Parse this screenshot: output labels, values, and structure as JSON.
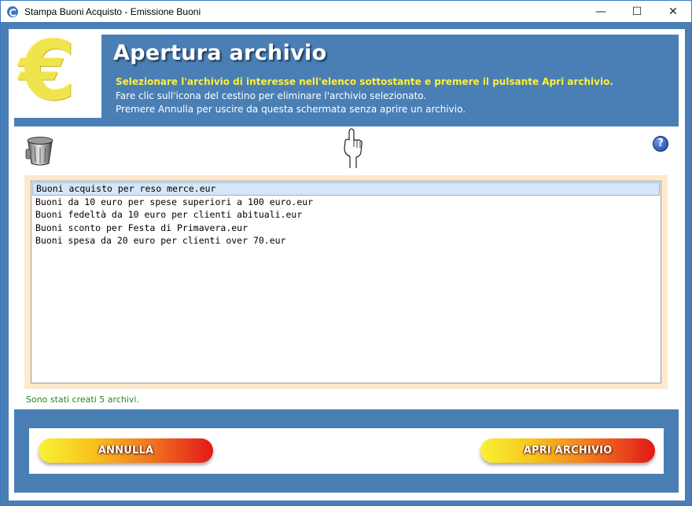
{
  "window": {
    "title": "Stampa Buoni Acquisto - Emissione Buoni",
    "minimize": "—",
    "maximize": "☐",
    "close": "✕"
  },
  "header": {
    "logo_symbol": "€",
    "title": "Apertura archivio",
    "line1": "Selezionare l'archivio di interesse nell'elenco sottostante e premere il pulsante Apri archivio.",
    "line2": "Fare clic sull'icona del cestino per eliminare l'archivio selezionato.",
    "line3": "Premere Annulla per uscire da questa schermata senza aprire un archivio.",
    "colors": {
      "background": "#4a7fb5",
      "highlight": "#ffef3a"
    }
  },
  "toolbar": {
    "help_label": "?",
    "icons": [
      "trash-icon",
      "pointing-hand-icon",
      "help-icon"
    ]
  },
  "file_list": {
    "items": [
      "Buoni acquisto per reso merce.eur",
      "Buoni da 10 euro per spese superiori a 100 euro.eur",
      "Buoni fedeltà da 10 euro per clienti abituali.eur",
      "Buoni sconto per Festa di Primavera.eur",
      "Buoni spesa da 20 euro per clienti over 70.eur"
    ],
    "selected_index": 0
  },
  "status": {
    "text": "Sono stati creati 5 archivi.",
    "color": "#1e8a1e"
  },
  "footer": {
    "cancel_label": "ANNULLA",
    "open_label": "APRI ARCHIVIO"
  }
}
